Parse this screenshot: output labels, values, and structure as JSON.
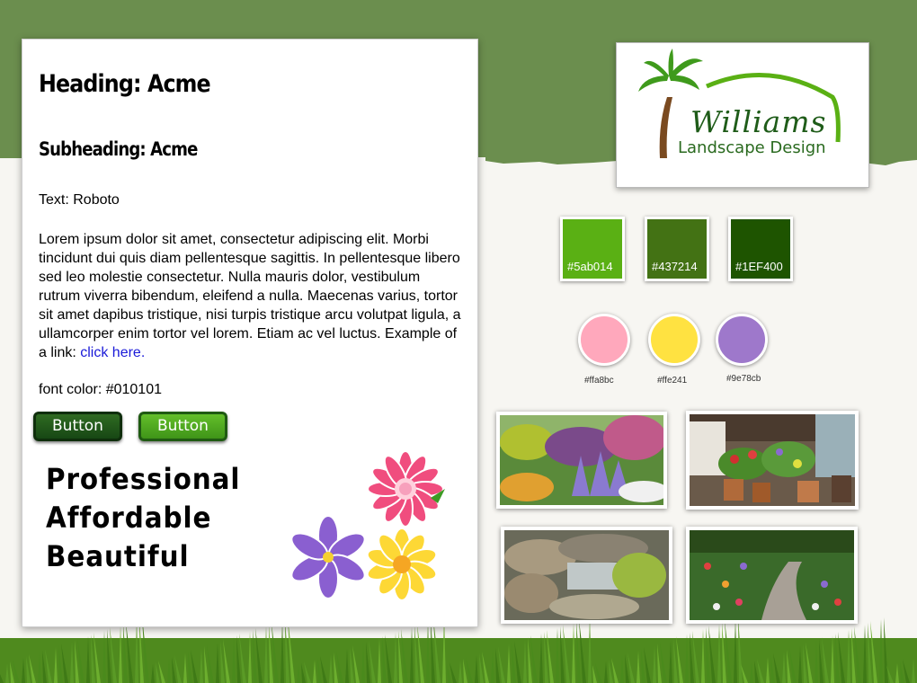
{
  "card": {
    "heading": "Heading: Acme",
    "subheading": "Subheading: Acme",
    "text_label": "Text: Roboto",
    "lorem": "Lorem ipsum dolor sit amet, consectetur adipiscing elit. Morbi tincidunt dui quis diam pellentesque sagittis. In pellentesque libero sed leo molestie consectetur. Nulla mauris dolor, vestibulum rutrum viverra bibendum, eleifend a nulla. Maecenas varius, tortor sit amet dapibus tristique, nisi turpis tristique  arcu volutpat ligula, a ullamcorper enim tortor vel lorem. Etiam ac vel luctus. Example of a link: ",
    "link_text": "click here.",
    "font_color_label": "font color: #010101",
    "button_dark": "Button",
    "button_light": "Button",
    "taglines": [
      "Professional",
      "Affordable",
      "Beautiful"
    ]
  },
  "logo": {
    "name": "Williams",
    "subtitle": "Landscape Design"
  },
  "swatches": [
    {
      "label": "#5ab014",
      "color": "#5ab014"
    },
    {
      "label": "#437214",
      "color": "#437214"
    },
    {
      "label": "#1EF400",
      "color": "#1e5400"
    }
  ],
  "dots": [
    {
      "label": "#ffa8bc",
      "color": "#ffa8bc"
    },
    {
      "label": "#ffe241",
      "color": "#ffe241"
    },
    {
      "label": "#9e78cb",
      "color": "#9e78cb"
    }
  ],
  "colors": {
    "header_green": "#6b8e4e",
    "link": "#1a1ad8",
    "text": "#010101"
  },
  "photos": [
    "garden-flowerbed",
    "patio-potted-plants",
    "rock-waterfall",
    "garden-path"
  ]
}
